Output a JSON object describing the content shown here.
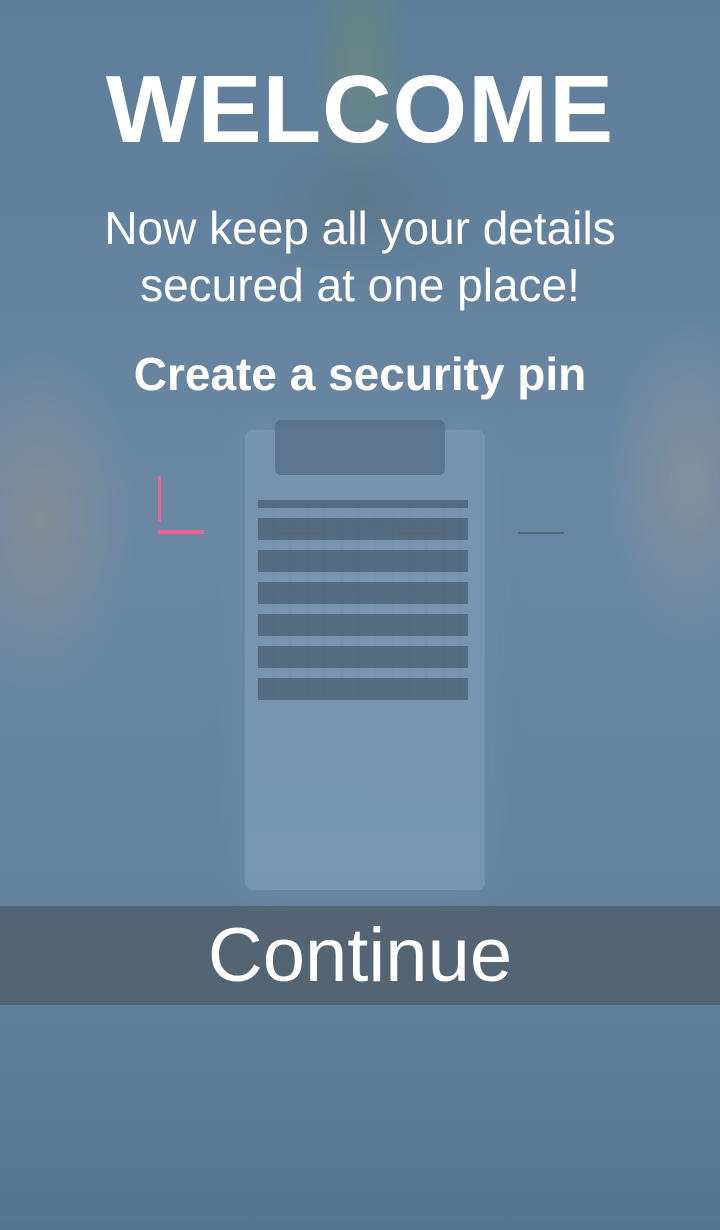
{
  "welcome": {
    "title": "WELCOME",
    "subtitle": "Now keep all your details\nsecured at one place!",
    "pin_prompt": "Create a security pin"
  },
  "pin": {
    "length": 4,
    "filled": 0,
    "active_index": 0,
    "accent_color": "#f06292"
  },
  "actions": {
    "continue_label": "Continue"
  },
  "colors": {
    "background": "#5f7f9c",
    "button_overlay": "#505c68"
  }
}
